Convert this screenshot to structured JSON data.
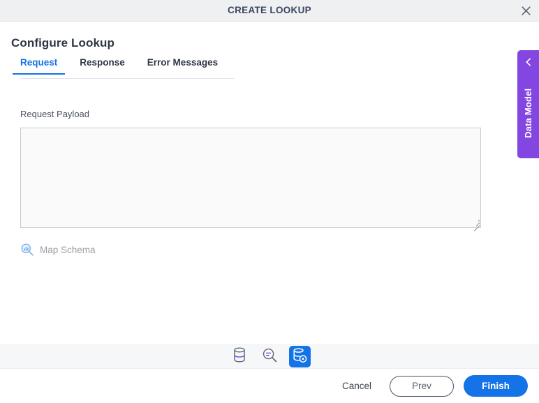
{
  "window": {
    "title": "CREATE LOOKUP",
    "close_icon": "close-icon"
  },
  "page": {
    "heading": "Configure Lookup"
  },
  "tabs": [
    {
      "label": "Request",
      "active": true
    },
    {
      "label": "Response",
      "active": false
    },
    {
      "label": "Error Messages",
      "active": false
    }
  ],
  "request_form": {
    "payload_label": "Request Payload",
    "payload_value": "",
    "payload_placeholder": "",
    "map_schema_label": "Map Schema",
    "map_schema_icon": "map-schema-search-icon"
  },
  "data_model_panel": {
    "label": "Data Model",
    "chevron_icon": "chevron-left-icon"
  },
  "icon_toolbar": [
    {
      "name": "database-icon",
      "title": "Database",
      "active": false
    },
    {
      "name": "query-search-icon",
      "title": "Query",
      "active": false
    },
    {
      "name": "configure-lookup-icon",
      "title": "Configure Lookup",
      "active": true
    }
  ],
  "footer": {
    "cancel_label": "Cancel",
    "prev_label": "Prev",
    "finish_label": "Finish"
  },
  "colors": {
    "accent_blue": "#1473e6",
    "data_model_purple": "#8346e0",
    "icon_purple": "#7b5ce0",
    "titlebar_bg": "#eff0f2",
    "toolbar_bg": "#f6f7f9",
    "title_text": "#3b4662"
  }
}
